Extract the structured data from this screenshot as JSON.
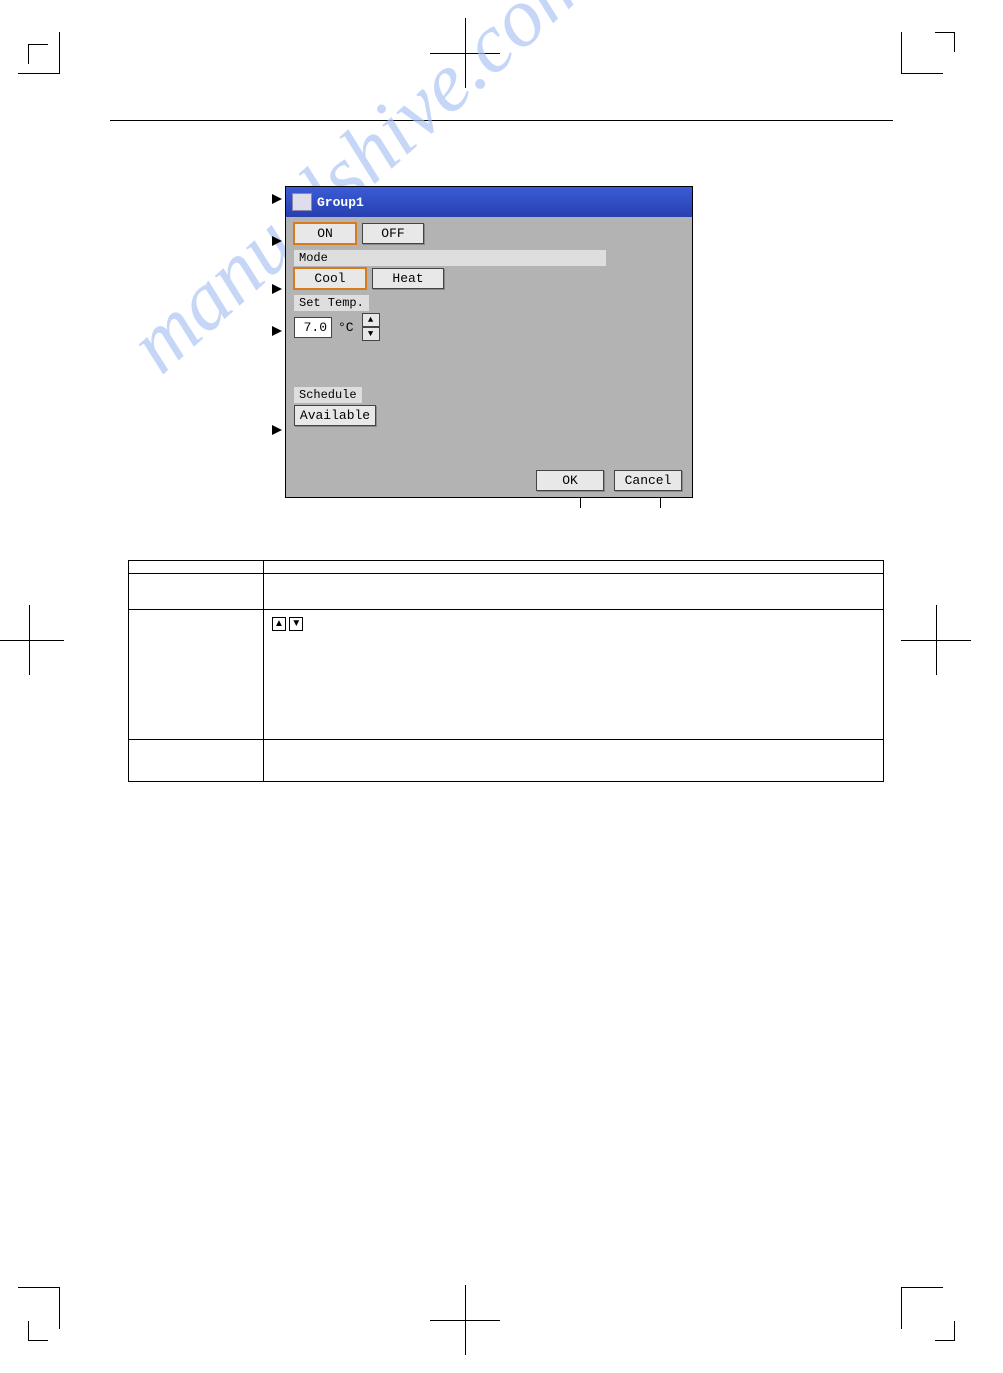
{
  "watermark": "manualshive.com",
  "dialog": {
    "title": "Group1",
    "on": "ON",
    "off": "OFF",
    "mode_label": "Mode",
    "cool": "Cool",
    "heat": "Heat",
    "set_temp_label": "Set Temp.",
    "temp_value": "7.0",
    "temp_unit": "°C",
    "schedule_label": "Schedule",
    "available": "Available",
    "ok": "OK",
    "cancel": "Cancel"
  },
  "table": {
    "rows": [
      {
        "name": "",
        "desc": ""
      },
      {
        "name": "",
        "desc": ""
      },
      {
        "name": "",
        "desc": ""
      },
      {
        "name": "",
        "desc": ""
      }
    ]
  },
  "icons": {
    "up": "▲",
    "down": "▼"
  }
}
